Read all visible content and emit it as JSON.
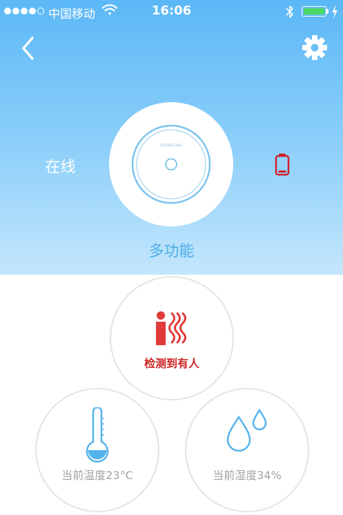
{
  "status_bar": {
    "carrier": "中国移动",
    "time": "16:06",
    "signal_bars_filled": 4,
    "signal_bars_total": 5,
    "battery_level": 1.0
  },
  "nav": {
    "back_icon": "chevron-left-icon",
    "settings_icon": "gear-icon"
  },
  "device": {
    "status": "在线",
    "brand": "SmartCare",
    "mode": "多功能",
    "battery_icon": "battery-low-icon",
    "battery_color": "#d0202c"
  },
  "sensors": {
    "motion": {
      "label": "检测到有人",
      "icon": "human-presence-icon",
      "color": "#e03a3a"
    },
    "temperature": {
      "label": "当前温度23°C",
      "icon": "thermometer-icon",
      "color": "#55b3ec"
    },
    "humidity": {
      "label": "当前湿度34%",
      "icon": "water-drops-icon",
      "color": "#55b3ec"
    }
  },
  "colors": {
    "header_top": "#5bb8f6",
    "header_bottom": "#c4e6fc",
    "accent": "#4aaee8"
  }
}
